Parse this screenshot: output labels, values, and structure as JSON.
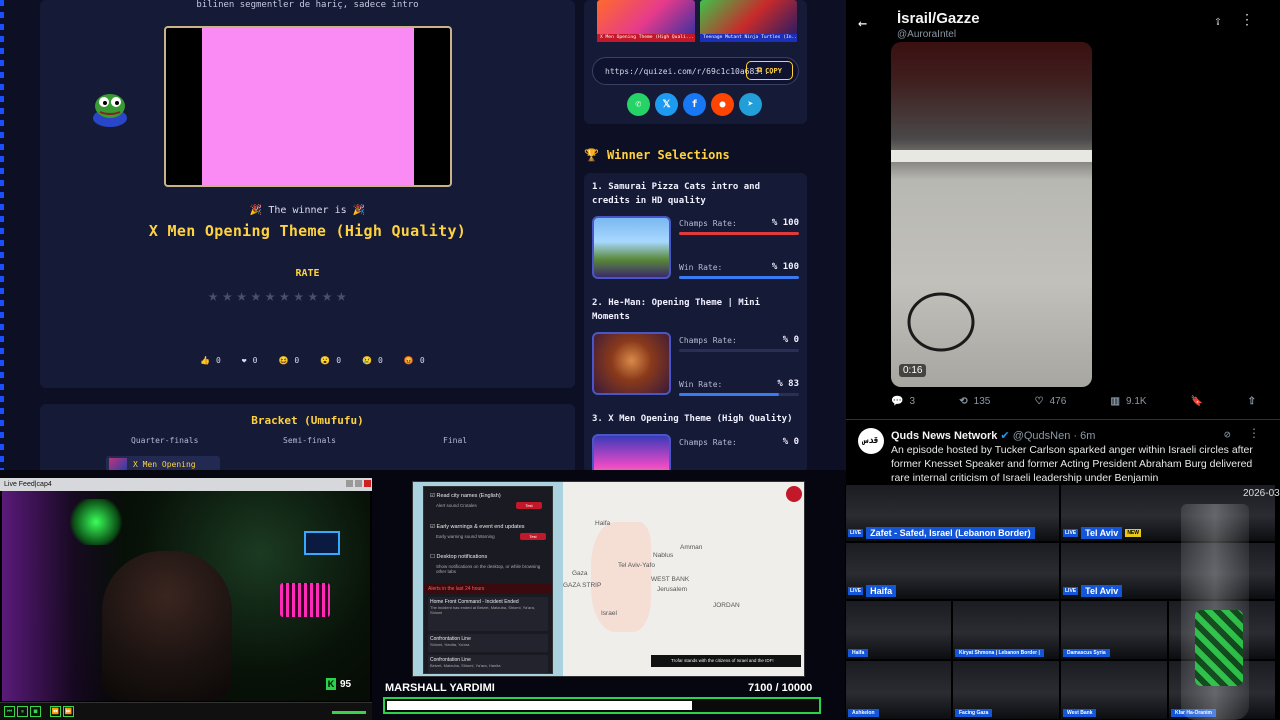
{
  "quiz": {
    "top_note": "bilinen segmentler de hariç, sadece intro",
    "winner_intro": "🎉 The winner is 🎉",
    "winner_name": "X Men Opening Theme (High Quality)",
    "rate_label": "RATE",
    "star_count": 10,
    "reactions": [
      {
        "icon": "👍",
        "count": "0"
      },
      {
        "icon": "❤",
        "count": "0"
      },
      {
        "icon": "😆",
        "count": "0"
      },
      {
        "icon": "😮",
        "count": "0"
      },
      {
        "icon": "😢",
        "count": "0"
      },
      {
        "icon": "😡",
        "count": "0"
      }
    ],
    "bracket": {
      "title": "Bracket (Umufufu)",
      "rounds": [
        "Quarter-finals",
        "Semi-finals",
        "Final"
      ],
      "first_item": "X Men Opening"
    },
    "share": {
      "thumb1_caption": "X Men Opening Theme (High Quali...",
      "thumb2_caption": "Teenage Mutant Ninja Turtles (In...",
      "url": "https://quizei.com/r/69c1c10a683...",
      "copy_label": "COPY",
      "socials": [
        {
          "name": "whatsapp",
          "glyph": "✆",
          "color": "#25d366"
        },
        {
          "name": "x",
          "glyph": "𝕏",
          "color": "#1d9bf0"
        },
        {
          "name": "facebook",
          "glyph": "f",
          "color": "#1877f2"
        },
        {
          "name": "reddit",
          "glyph": "●",
          "color": "#ff4500"
        },
        {
          "name": "telegram",
          "glyph": "➤",
          "color": "#229ed9"
        }
      ]
    },
    "winner_selections": {
      "heading": "Winner Selections",
      "champs_label": "Champs Rate:",
      "win_label": "Win Rate:",
      "items": [
        {
          "rank": "1.",
          "title": "Samurai Pizza Cats intro and credits in HD quality",
          "champs": "% 100",
          "champs_frac": 1.0,
          "win": "% 100",
          "win_frac": 1.0
        },
        {
          "rank": "2.",
          "title": "He-Man: Opening Theme | Mini Moments",
          "champs": "% 0",
          "champs_frac": 0,
          "win": "% 83",
          "win_frac": 0.83
        },
        {
          "rank": "3.",
          "title": "X Men Opening Theme (High Quality)",
          "champs": "% 0",
          "champs_frac": 0
        }
      ]
    }
  },
  "twitter": {
    "title": "İsrail/Gazze",
    "handle": "@AuroraIntel",
    "video_duration": "0:16",
    "actions": {
      "replies": "3",
      "reposts": "135",
      "likes": "476",
      "views": "9.1K"
    },
    "second_post": {
      "avatar_text": "قدس",
      "name": "Quds News Network",
      "handle_time": "@QudsNen · 6m",
      "body": "An episode hosted by Tucker Carlson sparked anger within Israeli circles after former Knesset Speaker and former Acting President Abraham Burg delivered rare internal criticism of Israeli leadership under Benjamin"
    }
  },
  "webcam": {
    "title": "Live Feed|cap4",
    "count": "95",
    "count_badge": "K"
  },
  "alert_map": {
    "settings": [
      {
        "label": "Read city names (English)",
        "sub": "Alert sound   Crotales"
      },
      {
        "label": "Early warnings & event end updates",
        "sub": "Early warning sound   Warning"
      },
      {
        "label": "Desktop notifications",
        "sub": "Show notifications on the desktop, or while browsing other tabs"
      }
    ],
    "test_label": "Test",
    "alerts_header": "Alerts in the last 24 hours",
    "alerts": [
      {
        "title": "Home Front Command - Incident Ended",
        "detail": "The incident has ended at Betzet, Matzuba, Shlomi, Ya'ara, Shlomi"
      },
      {
        "title": "Confrontation Line",
        "detail": "Shlomi, Hanita, Ya'ara"
      },
      {
        "title": "Confrontation Line",
        "detail": "Betzet, Matzuba, Shlomi, Ya'ara, Hanita"
      }
    ],
    "places": [
      "Haifa",
      "Tel Aviv-Yafo",
      "Nablus",
      "WEST BANK",
      "Amman",
      "Gaza",
      "GAZA STRIP",
      "Jerusalem",
      "Israel",
      "JORDAN"
    ],
    "banner": "Trofar stands with the citizens of Israel and the IDF!"
  },
  "donation": {
    "title": "MARSHALL YARDIMI",
    "value": "7100 / 10000",
    "progress": 0.71
  },
  "cameras": {
    "date": "2026-03",
    "feeds": [
      {
        "label": "Zafet - Safed, Israel (Lebanon Border)",
        "live": "LIVE"
      },
      {
        "label": "Tel Aviv",
        "live": "LIVE",
        "tag": "NEW"
      },
      {
        "label": "Haifa",
        "live": "LIVE"
      },
      {
        "label": "Tel Aviv",
        "live": "LIVE"
      },
      {
        "label": "Haifa"
      },
      {
        "label": "Kiryat Shmona | Lebanon Border |"
      },
      {
        "label": "Damascus Syria"
      },
      {
        "label": ""
      },
      {
        "label": "Ashkelon"
      },
      {
        "label": "Facing Gaza"
      },
      {
        "label": "West Bank"
      },
      {
        "label": "Kfar Ha-Oranim"
      }
    ]
  }
}
